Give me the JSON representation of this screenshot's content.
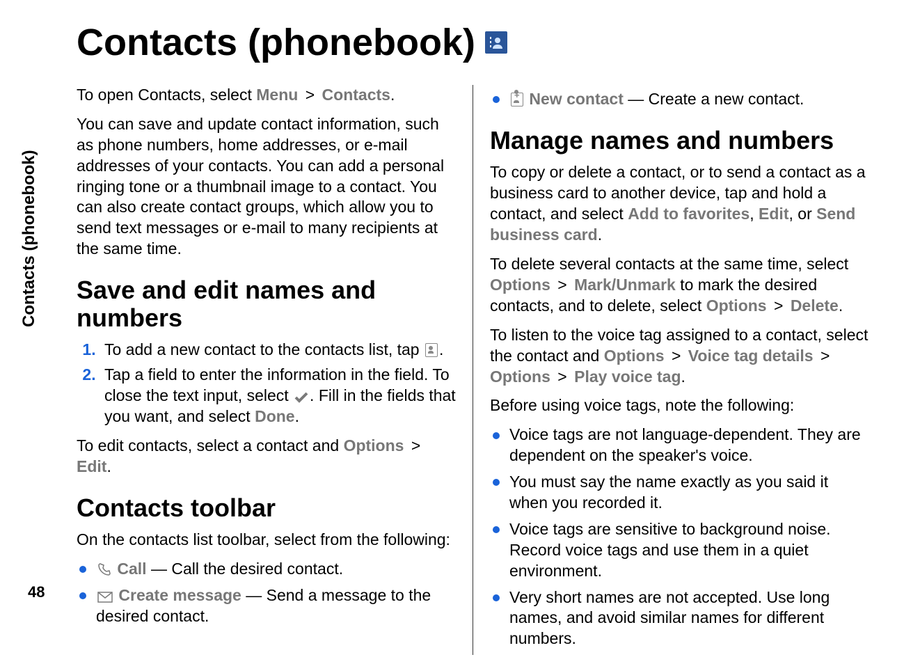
{
  "side_label": "Contacts (phonebook)",
  "page_number": "48",
  "title": "Contacts (phonebook)",
  "left": {
    "intro_open_prefix": "To open Contacts, select ",
    "menu": "Menu",
    "gt": ">",
    "contacts": "Contacts",
    "period": ".",
    "intro_body": "You can save and update contact information, such as phone numbers, home addresses, or e-mail addresses of your contacts. You can add a personal ringing tone or a thumbnail image to a contact. You can also create contact groups, which allow you to send text messages or e-mail to many recipients at the same time.",
    "h2_save": "Save and edit names and numbers",
    "ol1": "To add a new contact to the contacts list, tap ",
    "ol1_end": ".",
    "ol2_a": "Tap a field to enter the information in the field. To close the text input, select ",
    "ol2_b": ". Fill in the fields that you want, and select ",
    "done": "Done",
    "ol2_c": ".",
    "edit_prefix": "To edit contacts, select a contact and ",
    "options": "Options",
    "edit": "Edit",
    "h2_toolbar": "Contacts toolbar",
    "toolbar_intro": "On the contacts list toolbar, select from the following:",
    "tb_call_label": "Call",
    "tb_call_desc": " — Call the desired contact.",
    "tb_msg_label": "Create message",
    "tb_msg_desc": " — Send a message to the desired contact."
  },
  "right": {
    "tb_new_label": "New contact",
    "tb_new_desc": " — Create a new contact.",
    "h2_manage": "Manage names and numbers",
    "manage_p1_a": "To copy or delete a contact, or to send a contact as a business card to another device, tap and hold a contact, and select ",
    "add_fav": "Add to favorites",
    "comma_sp": ", ",
    "edit": "Edit",
    "or_sp": ", or ",
    "send_card": "Send business card",
    "period": ".",
    "manage_p2_a": "To delete several contacts at the same time, select ",
    "options": "Options",
    "gt": ">",
    "mark": "Mark/Unmark",
    "manage_p2_b": " to mark the desired contacts, and to delete, select ",
    "delete": "Delete",
    "manage_p3_a": "To listen to the voice tag assigned to a contact, select the contact and ",
    "voice_tag_details": "Voice tag details",
    "play_voice_tag": "Play voice tag",
    "notes_intro": "Before using voice tags, note the following:",
    "note1": "Voice tags are not language-dependent. They are dependent on the speaker's voice.",
    "note2": "You must say the name exactly as you said it when you recorded it.",
    "note3": "Voice tags are sensitive to background noise. Record voice tags and use them in a quiet environment.",
    "note4": "Very short names are not accepted. Use long names, and avoid similar names for different numbers."
  }
}
